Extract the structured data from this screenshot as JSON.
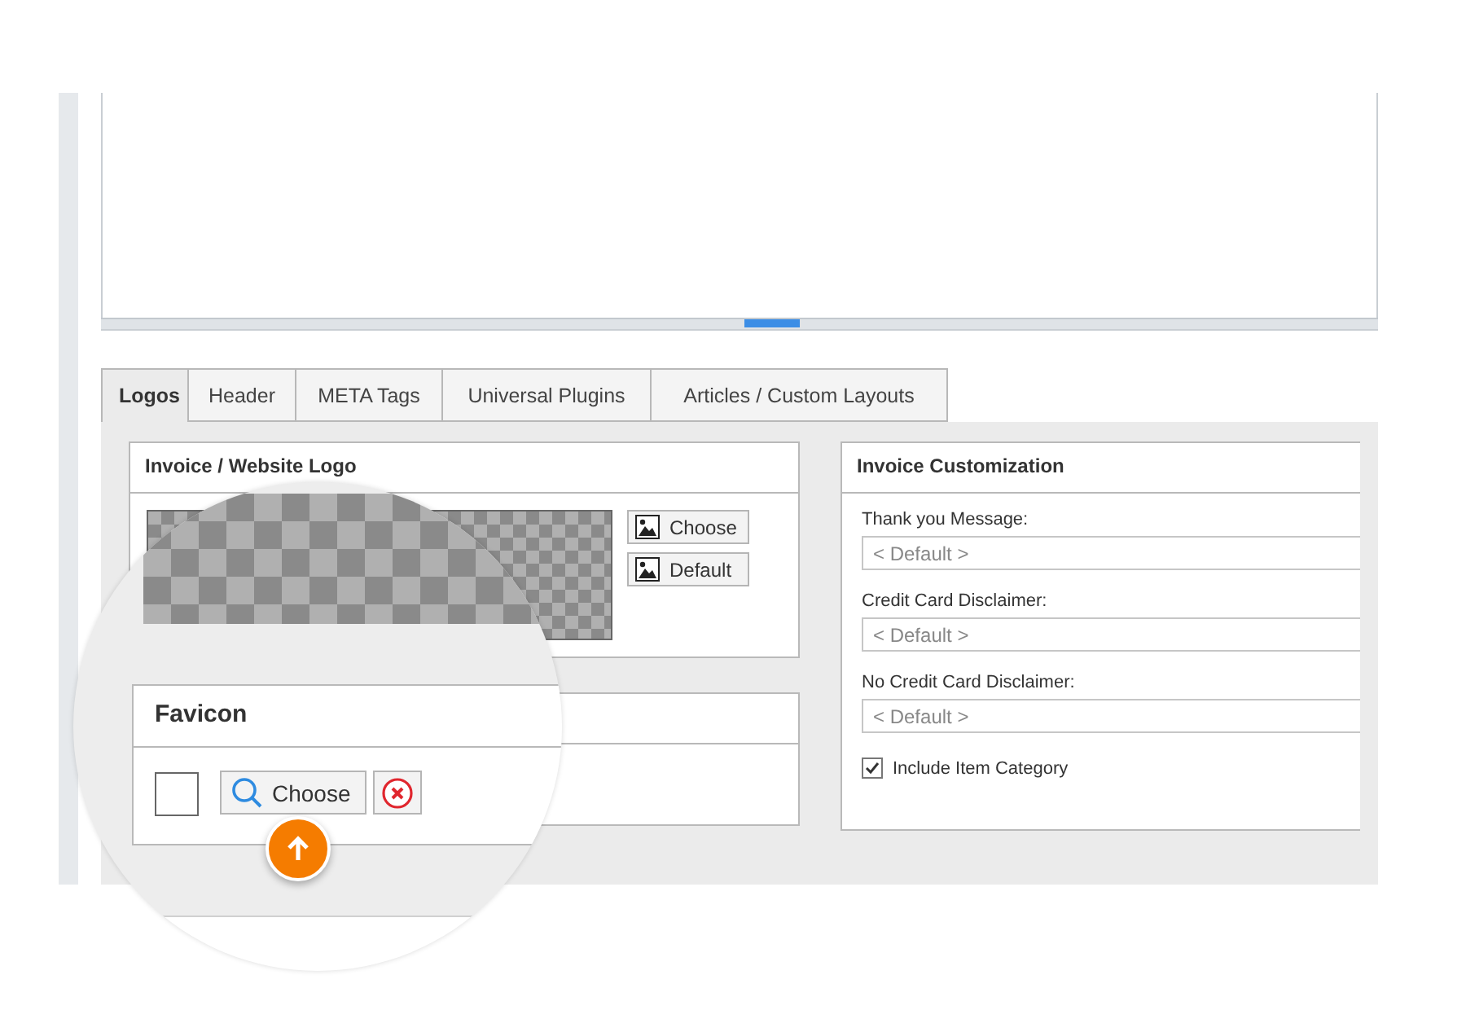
{
  "tabs": [
    {
      "label": "Logos",
      "selected": true
    },
    {
      "label": "Header",
      "selected": false
    },
    {
      "label": "META Tags",
      "selected": false
    },
    {
      "label": "Universal Plugins",
      "selected": false
    },
    {
      "label": "Articles / Custom Layouts",
      "selected": false
    }
  ],
  "logo_panel": {
    "title": "Invoice / Website Logo",
    "buttons": [
      "Choose",
      "Default"
    ]
  },
  "favicon_panel": {
    "title": "Favicon",
    "choose_label": "Choose"
  },
  "customization": {
    "title": "Invoice Customization",
    "fields": [
      {
        "label": "Thank you Message:",
        "placeholder": "< Default >"
      },
      {
        "label": "Credit Card Disclaimer:",
        "placeholder": "< Default >"
      },
      {
        "label": "No Credit Card Disclaimer:",
        "placeholder": "< Default >"
      }
    ],
    "checkbox": {
      "label": "Include Item Category",
      "checked": true
    }
  }
}
